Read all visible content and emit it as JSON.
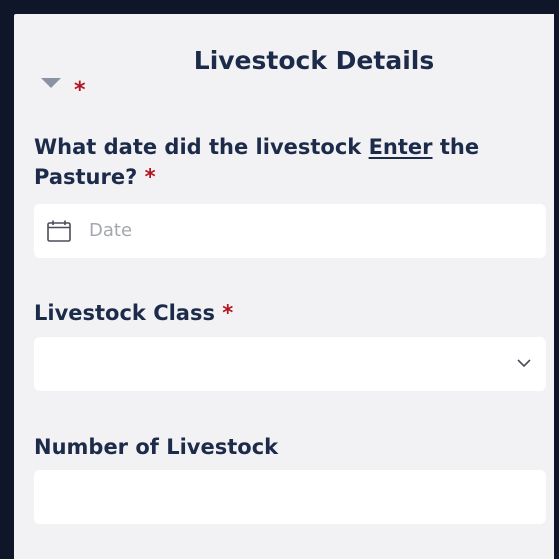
{
  "section": {
    "title": "Livestock Details",
    "required_marker": "*"
  },
  "fields": {
    "entry_date": {
      "label_before": "What date did the livestock ",
      "label_emphasis": "Enter",
      "label_after": " the Pasture?",
      "required_marker": "*",
      "placeholder": "Date",
      "icon": "calendar-icon"
    },
    "livestock_class": {
      "label": "Livestock Class",
      "required_marker": "*",
      "selected_value": "",
      "icon": "chevron-down-icon"
    },
    "number_of_livestock": {
      "label": "Number of Livestock",
      "value": ""
    }
  },
  "colors": {
    "frame": "#0f1629",
    "panel": "#f2f2f4",
    "label_text": "#1d2b4a",
    "required": "#b3141e",
    "placeholder": "#a3a8b0",
    "input_bg": "#ffffff"
  }
}
